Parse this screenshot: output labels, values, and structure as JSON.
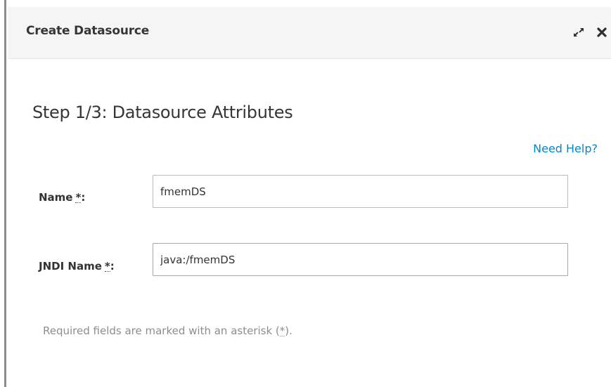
{
  "dialog": {
    "title": "Create Datasource",
    "maximize_icon": "expand-arrows-icon",
    "close_icon": "close-x-icon"
  },
  "step": {
    "title": "Step 1/3: Datasource Attributes"
  },
  "help": {
    "link_label": "Need Help?",
    "link_color": "#0088ce"
  },
  "fields": {
    "name": {
      "label": "Name",
      "required_marker": "*",
      "colon": ":",
      "value": "fmemDS"
    },
    "jndi_name": {
      "label": "JNDI Name",
      "required_marker": "*",
      "colon": ":",
      "value": "java:/fmemDS"
    }
  },
  "footer": {
    "note_prefix": "Required fields are marked with an asterisk (",
    "note_marker": "*",
    "note_suffix": ")."
  }
}
